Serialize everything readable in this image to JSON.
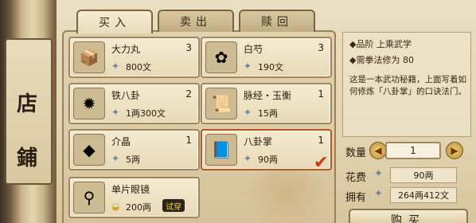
{
  "banner": {
    "chars": [
      "店",
      "鋪"
    ]
  },
  "tabs": [
    {
      "label": "买入",
      "active": true
    },
    {
      "label": "卖出",
      "active": false
    },
    {
      "label": "赎回",
      "active": false
    }
  ],
  "items": [
    {
      "name": "大力丸",
      "count": "3",
      "price": "800文",
      "icon": "medicine-box-icon",
      "glyph": "📦"
    },
    {
      "name": "白芍",
      "count": "3",
      "price": "190文",
      "icon": "white-flower-icon",
      "glyph": "✿"
    },
    {
      "name": "铁八卦",
      "count": "2",
      "price": "1两300文",
      "icon": "iron-bagua-icon",
      "glyph": "✹"
    },
    {
      "name": "脉经・玉衡",
      "count": "1",
      "price": "15两",
      "icon": "scroll-icon",
      "glyph": "📜"
    },
    {
      "name": "介晶",
      "count": "1",
      "price": "5两",
      "icon": "crystal-icon",
      "glyph": "◆"
    },
    {
      "name": "八卦掌",
      "count": "1",
      "price": "90两",
      "icon": "martial-book-icon",
      "glyph": "📘"
    },
    {
      "name": "单片眼镜",
      "count": "",
      "price": "200两",
      "icon": "monocle-icon",
      "glyph": "⚲",
      "badge": "试穿"
    }
  ],
  "info": {
    "grade_label": "◆品阶",
    "grade_value": "上乘武学",
    "req": "◆需拳法修为 80",
    "description": "这是一本武功秘籍，上面写着如何修炼「八卦掌」的口诀法门。"
  },
  "purchase": {
    "qty_label": "数量",
    "qty_value": "1",
    "cost_label": "花费",
    "cost_value": "90两",
    "own_label": "拥有",
    "own_value": "264两412文",
    "buy_label": "购买"
  },
  "colors": {
    "parchment": "#eadfc2",
    "frame": "#a08660",
    "check": "#c83a12"
  }
}
